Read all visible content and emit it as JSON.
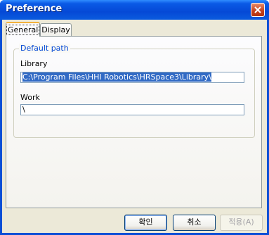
{
  "window": {
    "title": "Preference"
  },
  "tabs": [
    {
      "label": "General",
      "active": true
    },
    {
      "label": "Display",
      "active": false
    }
  ],
  "group": {
    "title": "Default path"
  },
  "library": {
    "label": "Library",
    "value": "C:\\Program Files\\HHI Robotics\\HRSpace3\\Library\\"
  },
  "work": {
    "label": "Work",
    "value": "\\"
  },
  "buttons": {
    "ok": "확인",
    "cancel": "취소",
    "apply": "적용(A)"
  },
  "colors": {
    "titlebar": "#0a5ae6",
    "group_label": "#0046d5",
    "selection": "#316ac5",
    "dialog_bg": "#ece9d8"
  },
  "icons": {
    "close": "close-icon"
  }
}
